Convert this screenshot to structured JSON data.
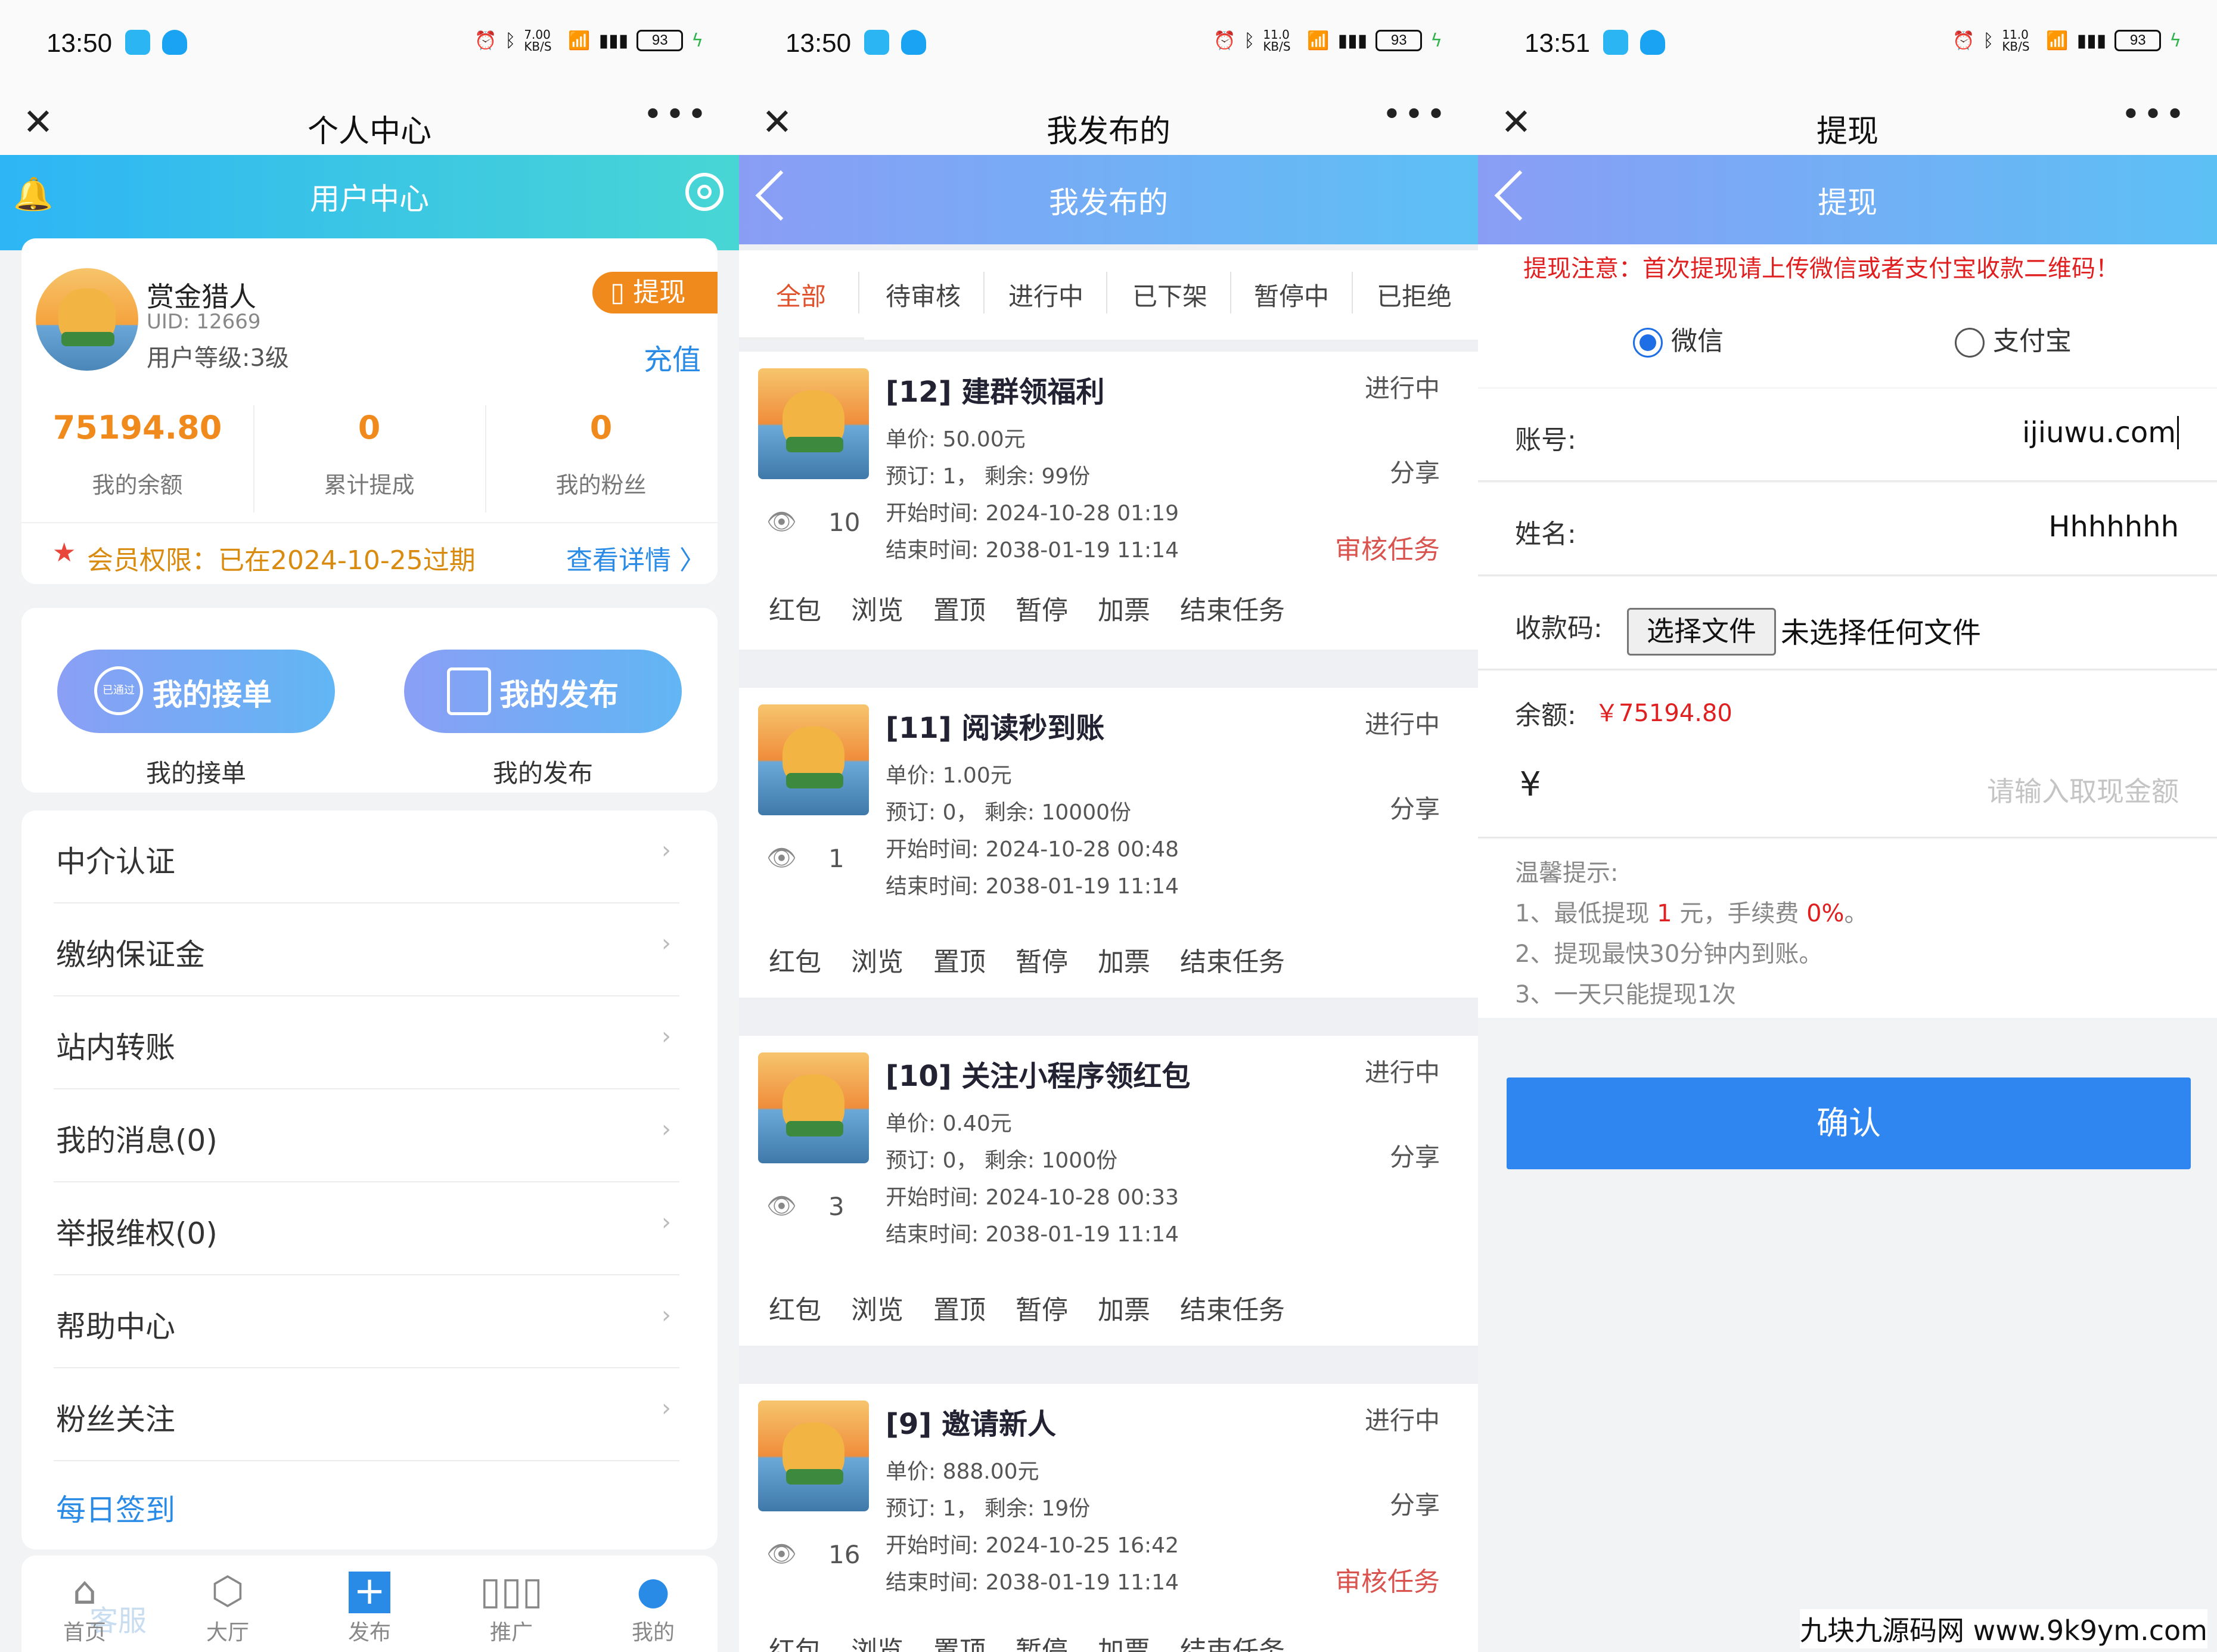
{
  "panels": [
    {
      "status_time": "13:50",
      "status_net": "7.00 KB/S",
      "battery": "93",
      "window_title": "个人中心",
      "header_title": "用户中心",
      "profile": {
        "name": "赏金猎人",
        "uid": "UID: 12669",
        "level": "用户等级:3级",
        "withdraw_btn": "提现",
        "recharge_btn": "充值"
      },
      "stats": [
        {
          "value": "75194.80",
          "label": "我的余额"
        },
        {
          "value": "0",
          "label": "累计提成"
        },
        {
          "value": "0",
          "label": "我的粉丝"
        }
      ],
      "membership": {
        "text": "会员权限：已在2024-10-25过期",
        "link": "查看详情"
      },
      "quick_buttons": [
        {
          "label": "我的接单",
          "caption": "我的接单",
          "stamp": "已通过"
        },
        {
          "label": "我的发布",
          "caption": "我的发布"
        }
      ],
      "menu": [
        "中介认证",
        "缴纳保证金",
        "站内转账",
        "我的消息(0)",
        "举报维权(0)",
        "帮助中心",
        "粉丝关注"
      ],
      "daily_checkin": "每日签到",
      "tabbar": [
        {
          "label": "首页",
          "icon": "home-icon"
        },
        {
          "label": "大厅",
          "icon": "cube-icon"
        },
        {
          "label": "发布",
          "icon": "plus-icon"
        },
        {
          "label": "推广",
          "icon": "chart-icon"
        },
        {
          "label": "我的",
          "icon": "user-icon"
        }
      ],
      "faded_overlay": "客服"
    },
    {
      "status_time": "13:50",
      "status_net": "11.0 KB/S",
      "battery": "93",
      "window_title": "我发布的",
      "header_title": "我发布的",
      "tabs": [
        "全部",
        "待审核",
        "进行中",
        "已下架",
        "暂停中",
        "已拒绝"
      ],
      "active_tab": "全部",
      "tasks": [
        {
          "title": "[12] 建群领福利",
          "status": "进行中",
          "price": "单价:   50.00元",
          "booked": "预订: 1， 剩余: 99份",
          "start": "开始时间: 2024-10-28 01:19",
          "end": "结束时间: 2038-01-19 11:14",
          "views": "10",
          "share": "分享",
          "audit": "审核任务"
        },
        {
          "title": "[11] 阅读秒到账",
          "status": "进行中",
          "price": "单价:   1.00元",
          "booked": "预订: 0， 剩余: 10000份",
          "start": "开始时间: 2024-10-28 00:48",
          "end": "结束时间: 2038-01-19 11:14",
          "views": "1",
          "share": "分享",
          "audit": ""
        },
        {
          "title": "[10] 关注小程序领红包",
          "status": "进行中",
          "price": "单价:   0.40元",
          "booked": "预订: 0， 剩余: 1000份",
          "start": "开始时间: 2024-10-28 00:33",
          "end": "结束时间: 2038-01-19 11:14",
          "views": "3",
          "share": "分享",
          "audit": ""
        },
        {
          "title": "[9] 邀请新人",
          "status": "进行中",
          "price": "单价:   888.00元",
          "booked": "预订: 1， 剩余: 19份",
          "start": "开始时间: 2024-10-25 16:42",
          "end": "结束时间: 2038-01-19 11:14",
          "views": "16",
          "share": "分享",
          "audit": "审核任务"
        }
      ],
      "actions": [
        "红包",
        "浏览",
        "置顶",
        "暂停",
        "加票",
        "结束任务"
      ]
    },
    {
      "status_time": "13:51",
      "status_net": "11.0 KB/S",
      "battery": "93",
      "window_title": "提现",
      "header_title": "提现",
      "notice": "提现注意：首次提现请上传微信或者支付宝收款二维码！",
      "pay_methods": [
        {
          "label": "微信",
          "selected": true
        },
        {
          "label": "支付宝",
          "selected": false
        }
      ],
      "account": {
        "label": "账号:",
        "value": "ijiuwu.com"
      },
      "name": {
        "label": "姓名:",
        "value": "Hhhhhhh"
      },
      "qrcode": {
        "label": "收款码:",
        "button": "选择文件",
        "status": "未选择任何文件"
      },
      "balance": {
        "label": "余额:",
        "value": "￥75194.80"
      },
      "amount": {
        "symbol": "¥",
        "placeholder": "请输入取现金额"
      },
      "tips_title": "温馨提示:",
      "tips": [
        {
          "pre": "1、最低提现 ",
          "em1": "1",
          "mid": " 元，手续费 ",
          "em2": "0%",
          "post": "。"
        },
        {
          "text": "2、提现最快30分钟内到账。"
        },
        {
          "text": "3、一天只能提现1次"
        }
      ],
      "confirm": "确认"
    }
  ],
  "watermark": "九块九源码网 www.9k9ym.com",
  "colors": {
    "accent_blue": "#2f86f0",
    "orange": "#f08a1c",
    "red": "#e02020",
    "cyan_gradient_start": "#2eb5f5",
    "cyan_gradient_end": "#48d6d4"
  }
}
